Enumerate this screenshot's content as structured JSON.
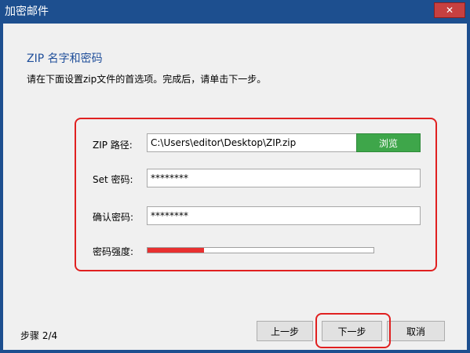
{
  "window": {
    "title": "加密邮件",
    "close_symbol": "✕"
  },
  "header": {
    "heading": "ZIP 名字和密码",
    "instruction": "请在下面设置zip文件的首选项。完成后，请单击下一步。"
  },
  "form": {
    "zip_path_label": "ZIP 路径:",
    "zip_path_value": "C:\\Users\\editor\\Desktop\\ZIP.zip",
    "browse_label": "浏览",
    "set_password_label": "Set 密码:",
    "set_password_value": "********",
    "confirm_password_label": "确认密码:",
    "confirm_password_value": "********",
    "strength_label": "密码强度:",
    "strength_percent": 25,
    "strength_color": "#e83030"
  },
  "footer": {
    "step_text": "步骤   2/4",
    "prev_label": "上一步",
    "next_label": "下一步",
    "cancel_label": "取消"
  },
  "colors": {
    "titlebar": "#1d4f8f",
    "heading": "#1f4e9a",
    "browse": "#3ea64a",
    "highlight": "#e02020"
  },
  "icons": {
    "close": "close-icon"
  }
}
